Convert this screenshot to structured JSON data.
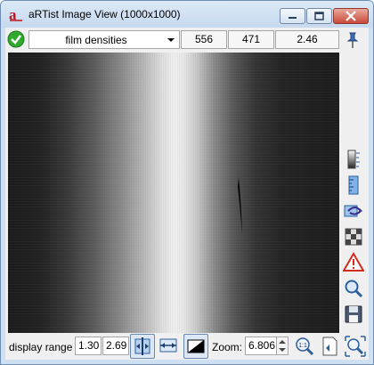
{
  "window": {
    "title": "aRTist Image View (1000x1000)",
    "icons": [
      "artist-logo-icon",
      "minimize-icon",
      "maximize-icon",
      "close-icon"
    ]
  },
  "toolbar": {
    "status_icon": "green-check-icon",
    "dropdown_selected": "film densities",
    "x_value": "556",
    "y_value": "471",
    "pixel_value": "2.46",
    "pin_icon": "pushpin-icon"
  },
  "image": {
    "description_icon": "xray-film-image"
  },
  "sidebar": {
    "tools": [
      "gradient-scale-icon",
      "ruler-icon",
      "profile-line-icon",
      "checkerboard-icon",
      "warning-icon",
      "magnifier-icon",
      "save-icon"
    ]
  },
  "statusbar": {
    "display_range_label": "display range",
    "range_min": "1.30",
    "range_max": "2.69",
    "zoom_label": "Zoom:",
    "zoom_value": "6.806"
  },
  "colors": {
    "titlebar": "#c6d9ef",
    "accent": "#6d8fb5",
    "ok_green": "#2faa2f",
    "warning_red": "#d42a1f"
  }
}
